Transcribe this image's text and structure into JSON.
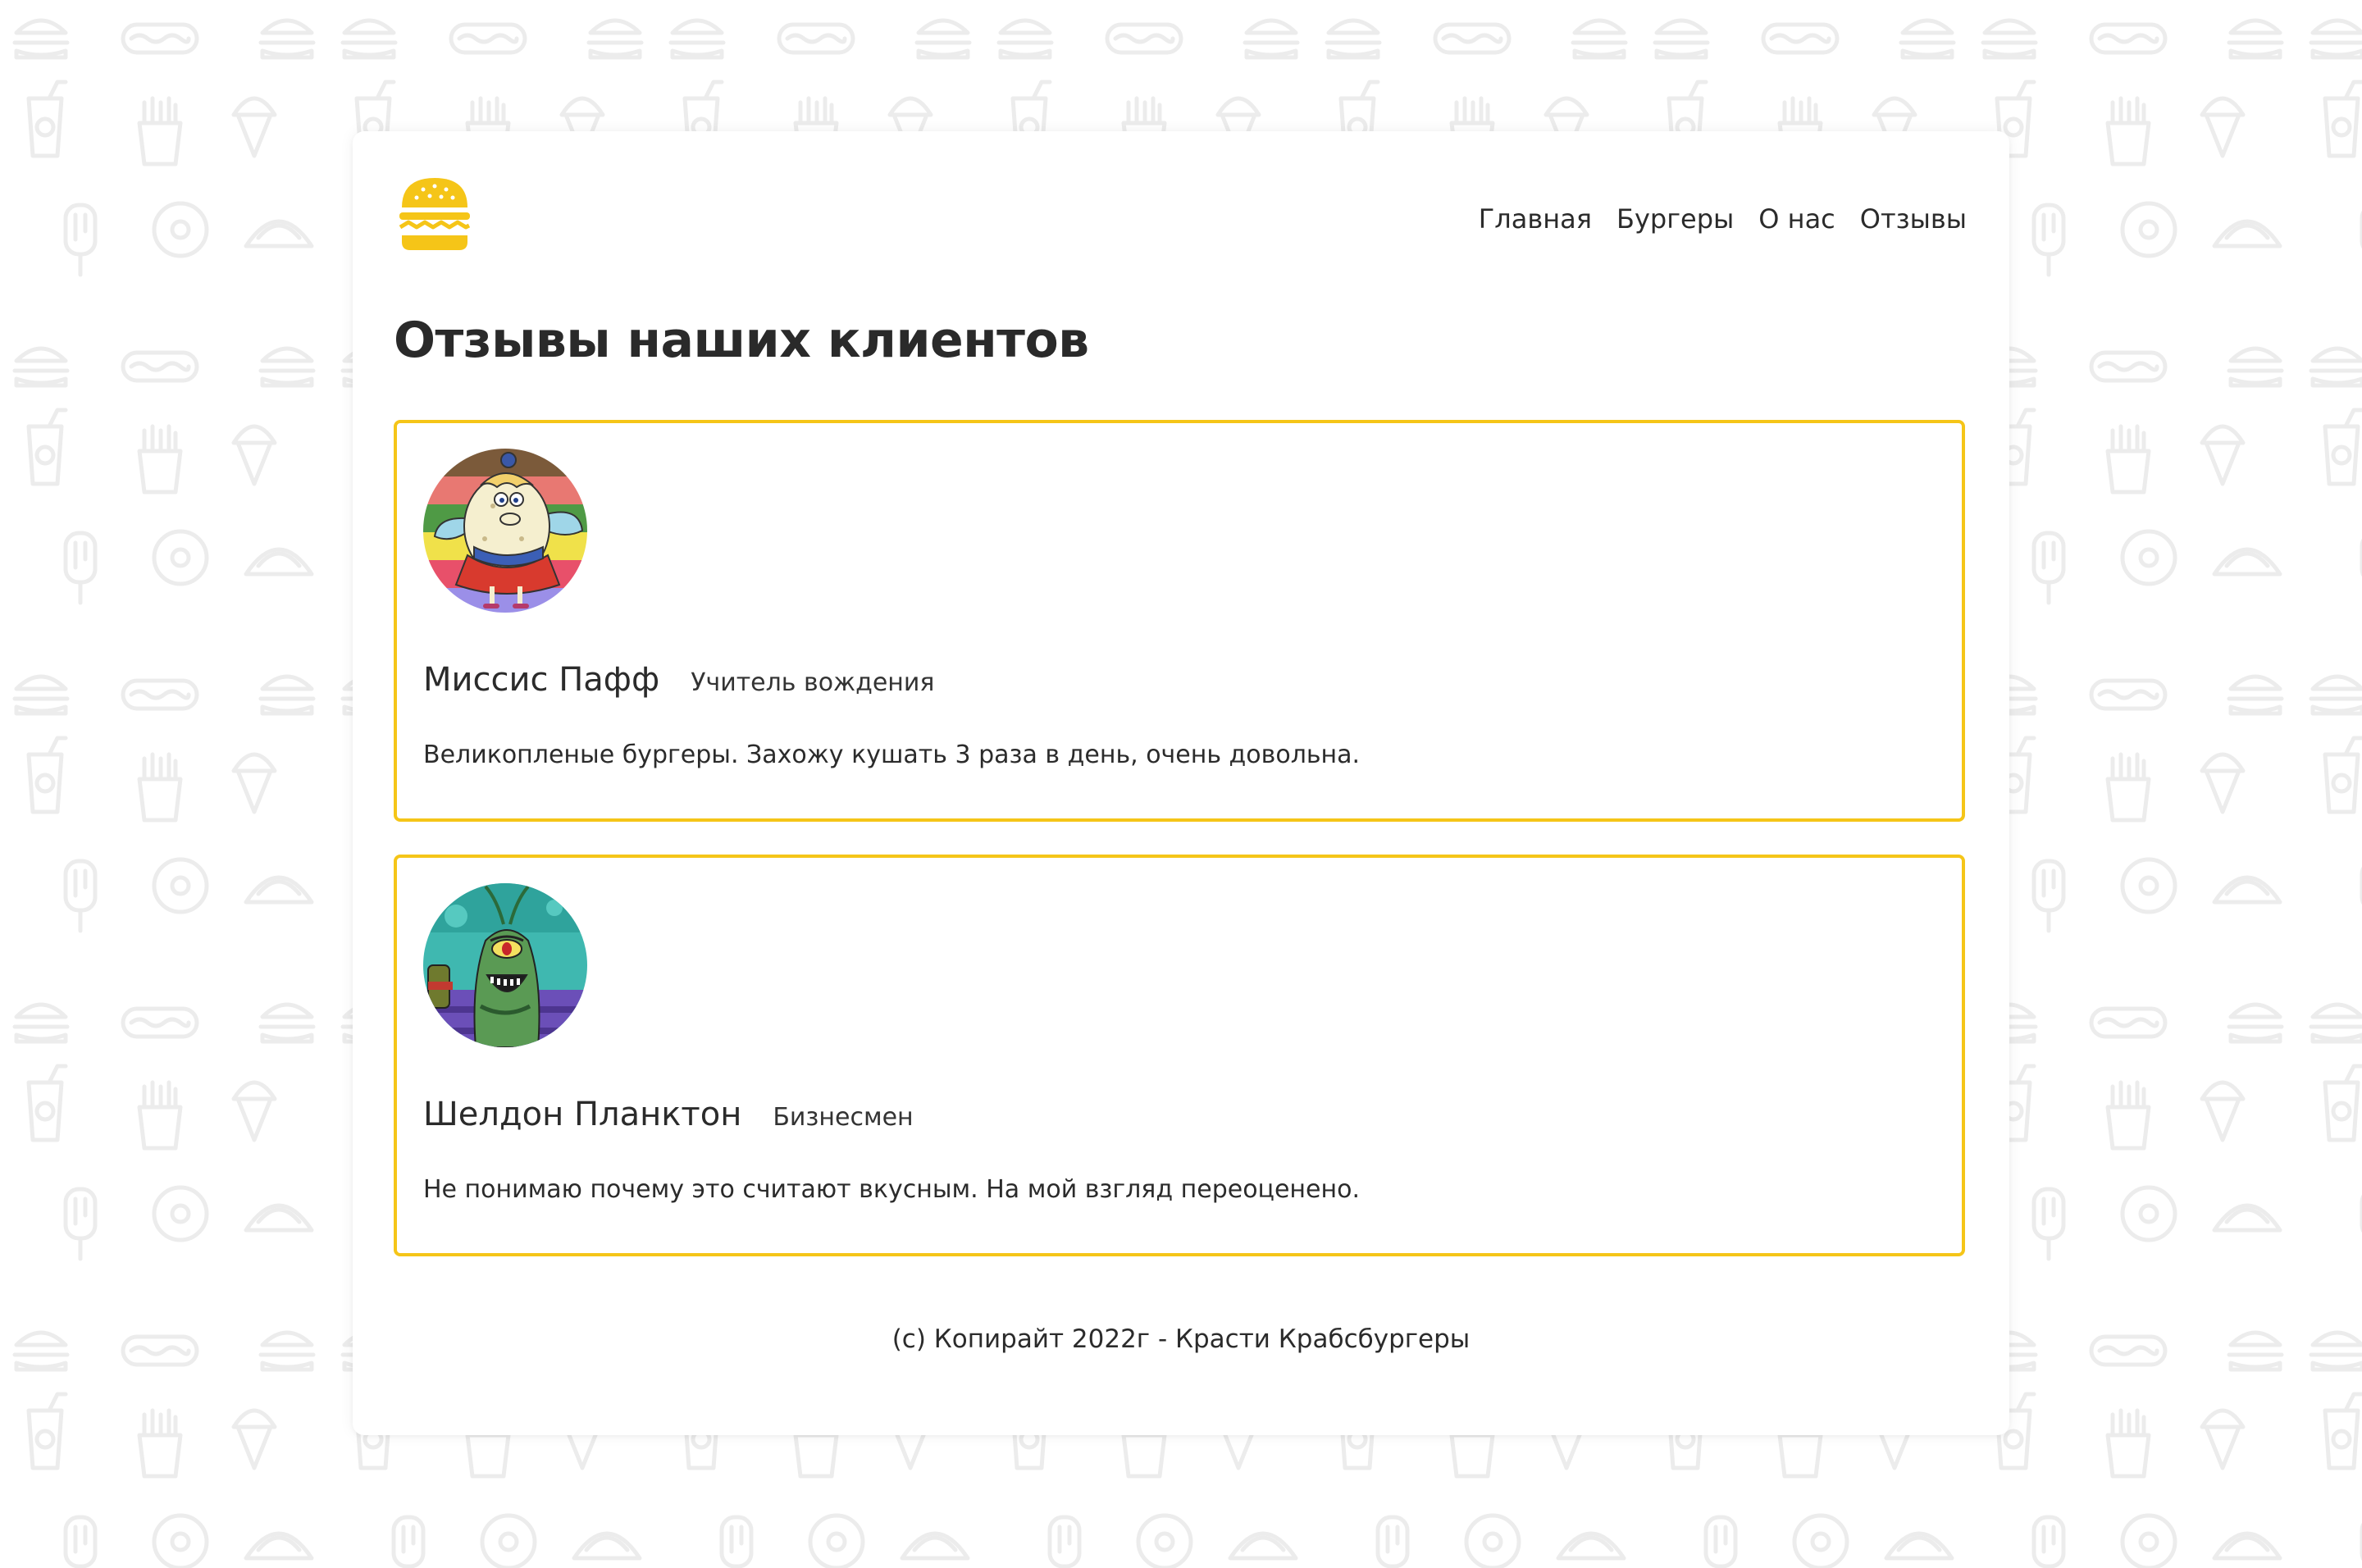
{
  "colors": {
    "accent": "#f5c518",
    "text": "#2b2b2b",
    "pattern": "#ececec"
  },
  "header": {
    "logo_icon": "burger-icon",
    "nav": [
      {
        "label": "Главная"
      },
      {
        "label": "Бургеры"
      },
      {
        "label": "О нас"
      },
      {
        "label": "Отзывы"
      }
    ]
  },
  "main": {
    "title": "Отзывы наших клиентов",
    "reviews": [
      {
        "name": "Миссис Пафф",
        "role": "Учитель вождения",
        "text": "Великопленые бургеры. Захожу кушать 3 раза в день, очень довольна.",
        "avatar_icon": "mrs-puff-avatar"
      },
      {
        "name": "Шелдон Планктон",
        "role": "Бизнесмен",
        "text": "Не понимаю почему это считают вкусным. На мой взгляд переоценено.",
        "avatar_icon": "plankton-avatar"
      }
    ]
  },
  "footer": {
    "text": "(c) Копирайт 2022г - Красти Крабсбургеры"
  }
}
